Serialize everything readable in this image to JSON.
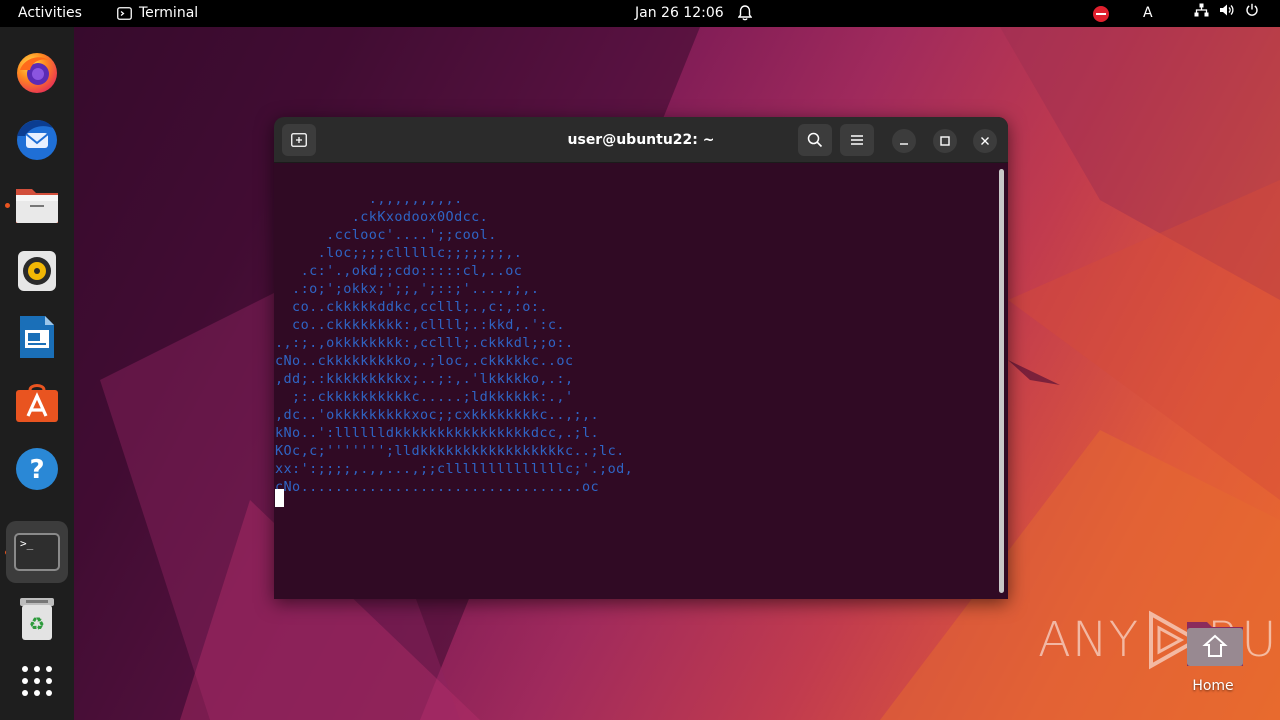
{
  "topbar": {
    "activities": "Activities",
    "app_name": "Terminal",
    "clock": "Jan 26  12:06",
    "input_source": "A"
  },
  "dock": {
    "items": [
      {
        "name": "Firefox",
        "icon": "firefox-icon"
      },
      {
        "name": "Thunderbird",
        "icon": "thunderbird-icon"
      },
      {
        "name": "Files",
        "icon": "files-icon"
      },
      {
        "name": "Rhythmbox",
        "icon": "rhythmbox-icon"
      },
      {
        "name": "LibreOffice Impress",
        "icon": "libreoffice-impress-icon"
      },
      {
        "name": "Ubuntu Software",
        "icon": "software-icon"
      },
      {
        "name": "Help",
        "icon": "help-icon"
      },
      {
        "name": "Terminal",
        "icon": "terminal-icon"
      },
      {
        "name": "Trash",
        "icon": "trash-icon"
      },
      {
        "name": "Show Applications",
        "icon": "app-grid-icon"
      }
    ],
    "terminal_glyph": ">_"
  },
  "terminal": {
    "title": "user@ubuntu22: ~",
    "output": "           .,,,,,,,,,.\n         .ckKxodoox0Odcc.\n      .cclooc'....';;cool.\n     .loc;;;;clllllc;;;;;;;,.\n   .c:'.,okd;;cdo:::::cl,..oc\n  .:o;';okkx;';;,';::;'....,;,.\n  co..ckkkkkddkc,cclll;.,c:,:o:.\n  co..ckkkkkkkk:,cllll;.:kkd,.':c.\n.,:;.,okkkkkkkk:,cclll;.ckkkdl;;o:.\ncNo..ckkkkkkkkko,.;loc,.ckkkkkc..oc\n,dd;.:kkkkkkkkkx;..;:,.'lkkkkko,.:,\n  ;:.ckkkkkkkkkkc.....;ldkkkkkk:.,'\n,dc..'okkkkkkkkkxoc;;cxkkkkkkkkc..,;,.\nkNo..':lllllldkkkkkkkkkkkkkkkkdcc,.;l.\nKOc,c;''''''';lldkkkkkkkkkkkkkkkkkc..;lc.\nxx:':;;;;,.,,...,;;cllllllllllllllc;'.;od,\ncNo.................................oc"
  },
  "watermark": {
    "text": "ANY",
    "text2": "RUN"
  },
  "desktop": {
    "home_label": "Home"
  },
  "colors": {
    "accent": "#e95420",
    "terminal_bg": "#300a24",
    "ascii_blue": "#2f64c4"
  }
}
